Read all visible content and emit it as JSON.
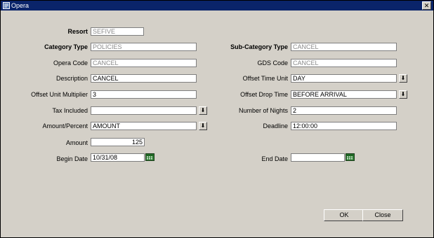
{
  "window": {
    "title": "Opera",
    "icon": "opera-app-icon",
    "close_glyph": "✕"
  },
  "form": {
    "resort": {
      "label": "Resort",
      "value": "SEFIVE"
    },
    "category_type": {
      "label": "Category Type",
      "value": "POLICIES"
    },
    "sub_category_type": {
      "label": "Sub-Category Type",
      "value": "CANCEL"
    },
    "opera_code": {
      "label": "Opera Code",
      "value": "CANCEL"
    },
    "gds_code": {
      "label": "GDS Code",
      "value": "CANCEL"
    },
    "description": {
      "label": "Description",
      "value": "CANCEL"
    },
    "offset_time_unit": {
      "label": "Offset Time Unit",
      "value": "DAY"
    },
    "offset_unit_multiplier": {
      "label": "Offset Unit Multiplier",
      "value": "3"
    },
    "offset_drop_time": {
      "label": "Offset Drop Time",
      "value": "BEFORE ARRIVAL"
    },
    "tax_included": {
      "label": "Tax Included",
      "value": ""
    },
    "number_of_nights": {
      "label": "Number of Nights",
      "value": "2"
    },
    "amount_percent": {
      "label": "Amount/Percent",
      "value": "AMOUNT"
    },
    "deadline": {
      "label": "Deadline",
      "value": "12:00:00"
    },
    "amount": {
      "label": "Amount",
      "value": "125"
    },
    "begin_date": {
      "label": "Begin Date",
      "value": "10/31/08"
    },
    "end_date": {
      "label": "End Date",
      "value": ""
    },
    "dropdown_glyph": "⬇"
  },
  "buttons": {
    "ok": "OK",
    "close": "Close"
  },
  "colors": {
    "titlebar": "#0a246a",
    "window_bg": "#d4d0c8",
    "disabled_text": "#8a8a8a"
  }
}
